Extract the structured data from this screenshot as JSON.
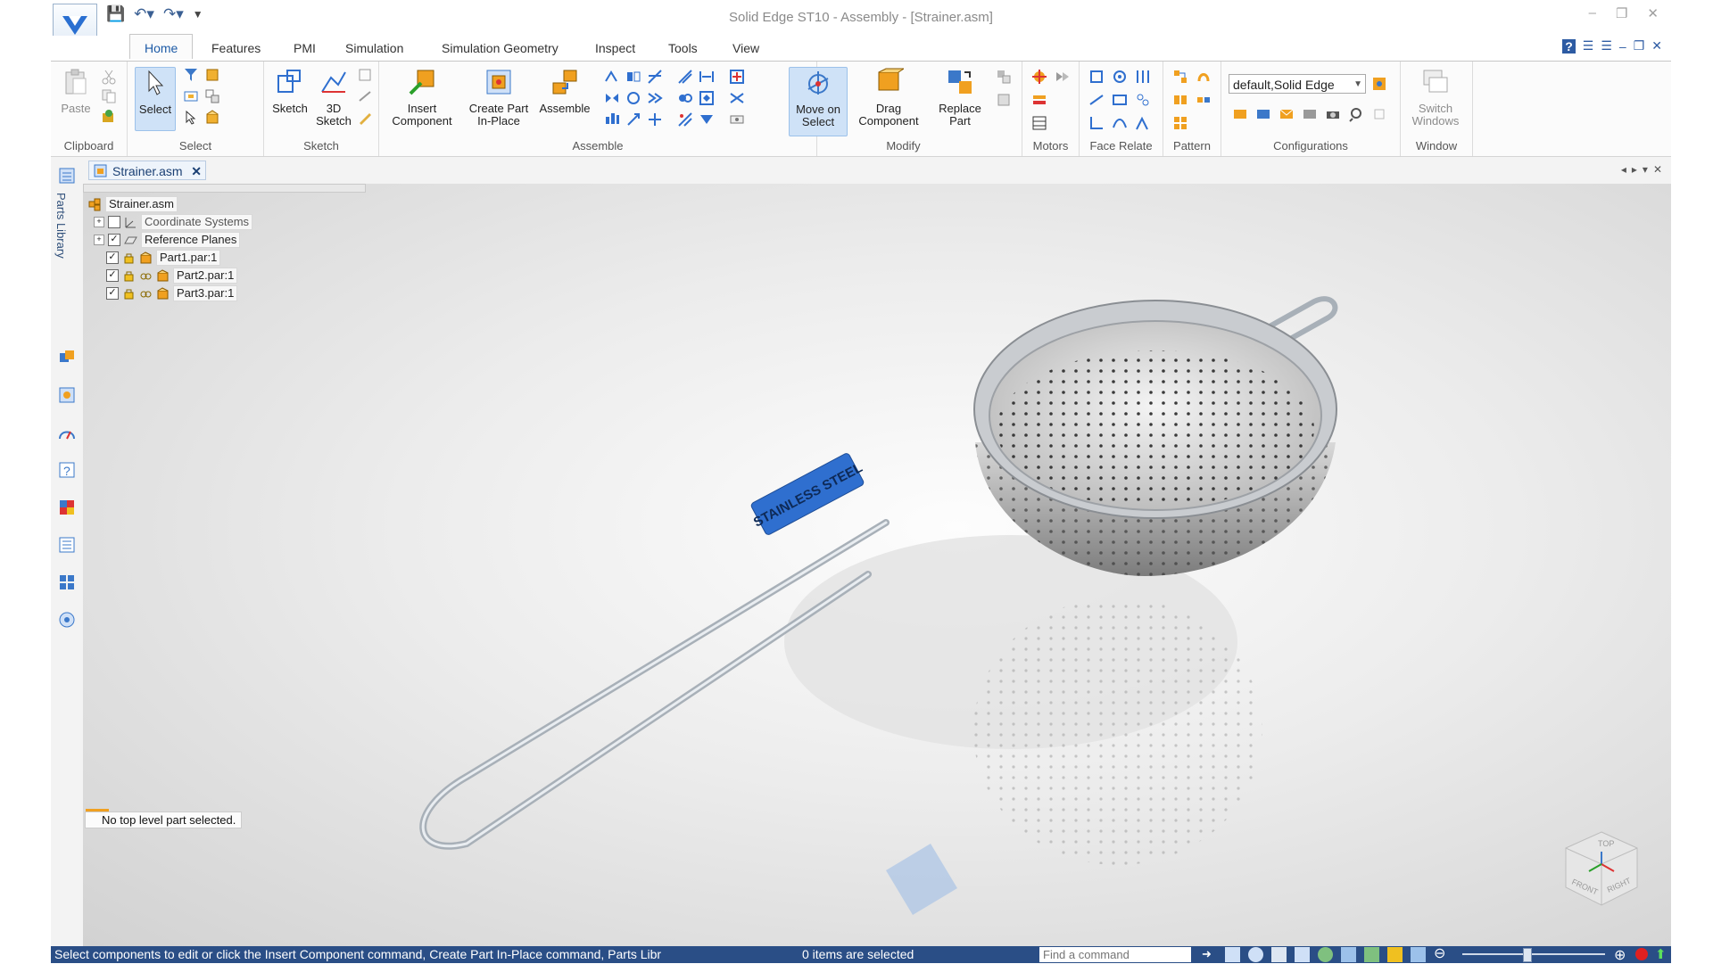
{
  "window": {
    "title": "Solid Edge ST10 - Assembly - [Strainer.asm]"
  },
  "tabs": [
    "Home",
    "Features",
    "PMI",
    "Simulation",
    "Simulation Geometry",
    "Inspect",
    "Tools",
    "View"
  ],
  "ribbon": {
    "clipboard": {
      "label": "Clipboard",
      "paste": "Paste"
    },
    "select": {
      "label": "Select",
      "select_btn": "Select"
    },
    "sketch": {
      "label": "Sketch",
      "sketch_btn": "Sketch",
      "sketch3d_line1": "3D",
      "sketch3d_line2": "Sketch"
    },
    "assemble": {
      "label": "Assemble",
      "insert_line1": "Insert",
      "insert_line2": "Component",
      "create_line1": "Create Part",
      "create_line2": "In-Place",
      "assemble_btn": "Assemble"
    },
    "modify": {
      "label": "Modify",
      "move_line1": "Move on",
      "move_line2": "Select",
      "drag_line1": "Drag",
      "drag_line2": "Component",
      "replace_line1": "Replace",
      "replace_line2": "Part"
    },
    "motors": {
      "label": "Motors"
    },
    "face_relate": {
      "label": "Face Relate"
    },
    "pattern": {
      "label": "Pattern"
    },
    "configurations": {
      "label": "Configurations",
      "combo_value": "default,Solid Edge"
    },
    "window": {
      "label": "Window",
      "switch_line1": "Switch",
      "switch_line2": "Windows"
    }
  },
  "document_tab": {
    "name": "Strainer.asm"
  },
  "left_rail": {
    "label": "Parts Library"
  },
  "tree": {
    "root": "Strainer.asm",
    "nodes": [
      {
        "label": "Coordinate Systems",
        "checked": false
      },
      {
        "label": "Reference Planes",
        "checked": true
      },
      {
        "label": "Part1.par:1",
        "checked": true
      },
      {
        "label": "Part2.par:1",
        "checked": true
      },
      {
        "label": "Part3.par:1",
        "checked": true
      }
    ]
  },
  "viewport": {
    "message": "No top level part selected.",
    "handle_text": "STAINLESS STEEL",
    "cube_top": "TOP",
    "cube_front": "FRONT",
    "cube_right": "RIGHT"
  },
  "statusbar": {
    "message": "Select components to edit or click the Insert Component command, Create Part In-Place command, Parts Libr",
    "selection_count": "0 items are selected",
    "find_placeholder": "Find a command"
  },
  "colors": {
    "accent": "#2a4e86",
    "handle": "#2f6fcf",
    "ribbon_bg": "#fbfbfb"
  }
}
